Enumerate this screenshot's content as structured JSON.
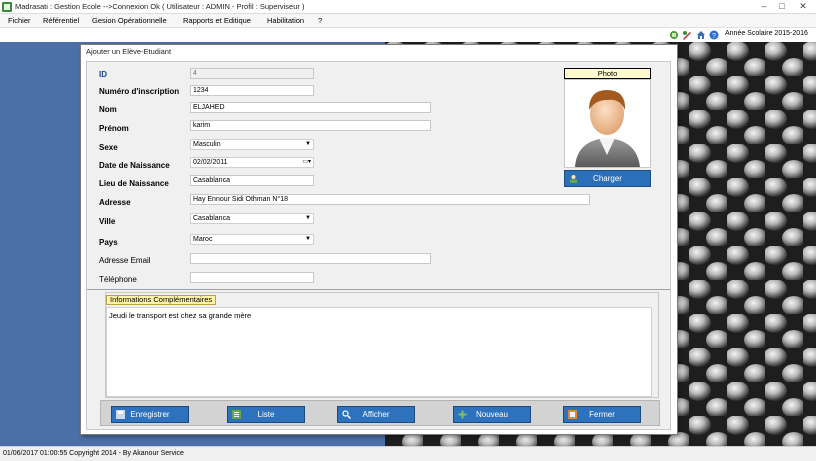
{
  "window": {
    "title": "Madrasati : Gestion Ecole -->Connexion Ok ( Utilisateur : ADMIN - Profil : Superviseur )"
  },
  "menu": [
    "Fichier",
    "Référentiel",
    "Gesion Opérationnelle",
    "Rapports et Editique",
    "Habilitation",
    "?"
  ],
  "toolbar": {
    "school_year": "Année Scolaire 2015-2016",
    "icons": [
      "refresh-icon",
      "tools-icon",
      "home-icon",
      "help-icon"
    ]
  },
  "dialog": {
    "title": "Ajouter un Elève-Etudiant",
    "labels": {
      "id": "ID",
      "numero": "Numéro d'inscription",
      "nom": "Nom",
      "prenom": "Prénom",
      "sexe": "Sexe",
      "date_naissance": "Date de Naissance",
      "lieu_naissance": "Lieu de Naissance",
      "adresse": "Adresse",
      "ville": "Ville",
      "pays": "Pays",
      "email": "Adresse Email",
      "telephone": "Téléphone"
    },
    "values": {
      "id": "4",
      "numero": "1234",
      "nom": "ELJAHED",
      "prenom": "karim",
      "sexe": "Masculin",
      "date_naissance": "02/02/2011",
      "lieu_naissance": "Casablanca",
      "adresse": "Hay Ennour Sidi Othman N°18",
      "ville": "Casablanca",
      "pays": "Maroc",
      "email": "",
      "telephone": ""
    },
    "photo": {
      "header": "Photo",
      "charger_label": "Charger"
    },
    "info": {
      "title": "Informations Complémentaires",
      "text": "Jeudi le transport est chez sa grande mère"
    },
    "buttons": {
      "enregistrer": "Enregistrer",
      "liste": "Liste",
      "afficher": "Afficher",
      "nouveau": "Nouveau",
      "fermer": "Fermer"
    }
  },
  "status": {
    "text": "01/06/2017 01:00:55   Copyright 2014 - By Akanour Service"
  },
  "colors": {
    "button": "#2e72be",
    "mdi_background": "#4c6fa7",
    "photo_header": "#fffacd"
  }
}
